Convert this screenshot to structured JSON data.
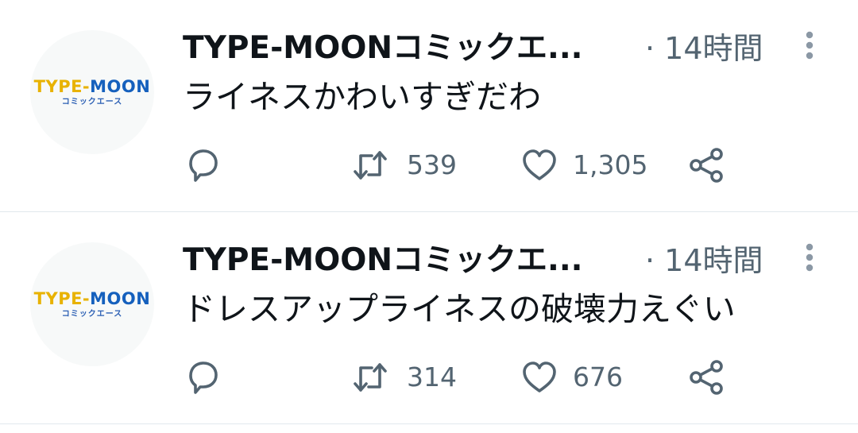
{
  "tweets": [
    {
      "avatar": {
        "logo_text": "TYPE-MOON",
        "logo_sub": "コミックエース"
      },
      "author": "TYPE-MOONコミックエ...",
      "time": "· 14時間",
      "text": "ライネスかわいすぎだわ",
      "reply_count": "",
      "retweet_count": "539",
      "like_count": "1,305"
    },
    {
      "avatar": {
        "logo_text": "TYPE-MOON",
        "logo_sub": "コミックエース"
      },
      "author": "TYPE-MOONコミックエ...",
      "time": "· 14時間",
      "text": "ドレスアップライネスの破壊力えぐい",
      "reply_count": "",
      "retweet_count": "314",
      "like_count": "676"
    }
  ],
  "colors": {
    "text": "#0f1419",
    "secondary": "#536471",
    "divider": "#e1e8ed",
    "logo_yellow": "#e8b200",
    "logo_blue": "#1560bd"
  },
  "icons": {
    "more": "more-vertical-icon",
    "reply": "reply-icon",
    "retweet": "retweet-icon",
    "like": "heart-icon",
    "share": "share-icon"
  }
}
